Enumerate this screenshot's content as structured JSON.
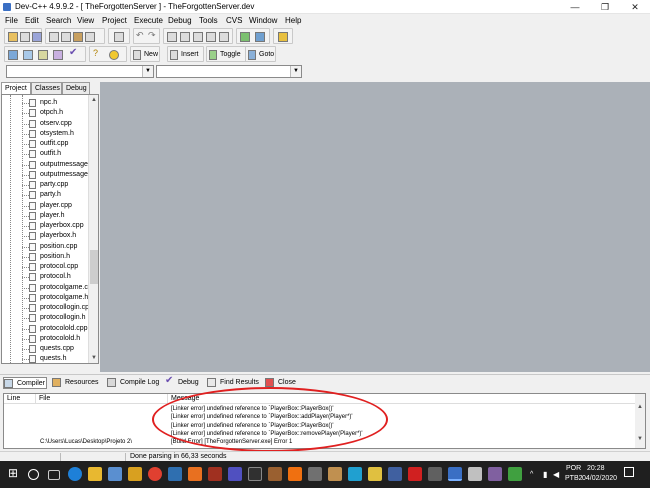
{
  "window": {
    "title": "Dev-C++ 4.9.9.2  -  [ TheForgottenServer ]  -  TheForgottenServer.dev",
    "minimize": "—",
    "maximize": "❐",
    "close": "✕"
  },
  "menu": [
    "File",
    "Edit",
    "Search",
    "View",
    "Project",
    "Execute",
    "Debug",
    "Tools",
    "CVS",
    "Window",
    "Help"
  ],
  "toolbar2": {
    "new_label": "New",
    "insert_label": "Insert",
    "toggle_label": "Toggle",
    "goto_label": "Goto"
  },
  "left_tabs": [
    "Project",
    "Classes",
    "Debug"
  ],
  "tree_items": [
    "npc.h",
    "otpch.h",
    "otserv.cpp",
    "otsystem.h",
    "outfit.cpp",
    "outfit.h",
    "outputmessage",
    "outputmessage",
    "party.cpp",
    "party.h",
    "player.cpp",
    "player.h",
    "playerbox.cpp",
    "playerbox.h",
    "position.cpp",
    "position.h",
    "protocol.cpp",
    "protocol.h",
    "protocolgame.c",
    "protocolgame.h",
    "protocollogin.cp",
    "protocollogin.h",
    "protocolold.cpp",
    "protocolold.h",
    "quests.cpp",
    "quests.h"
  ],
  "bottom_tabs": [
    "Compiler",
    "Resources",
    "Compile Log",
    "Debug",
    "Find Results",
    "Close"
  ],
  "messages": {
    "headers": {
      "line": "Line",
      "file": "File",
      "message": "Message"
    },
    "rows": [
      {
        "file": "",
        "message": "[Linker error] undefined reference to `PlayerBox::PlayerBox()'"
      },
      {
        "file": "",
        "message": "[Linker error] undefined reference to `PlayerBox::addPlayer(Player*)'"
      },
      {
        "file": "",
        "message": "[Linker error] undefined reference to `PlayerBox::PlayerBox()'"
      },
      {
        "file": "",
        "message": "[Linker error] undefined reference to `PlayerBox::removePlayer(Player*)'"
      },
      {
        "file": "C:\\Users\\Lucas\\Desktop\\Projeto 2\\",
        "message": "[Build Error]  [TheForgottenServer.exe] Error 1"
      }
    ]
  },
  "statusbar": {
    "text": "Done parsing in 66,33 seconds"
  },
  "taskbar": {
    "lang_top": "POR",
    "lang_bottom": "PTB2",
    "time": "20:28",
    "date": "04/02/2020"
  },
  "colors": {
    "annotation": "#e02020",
    "taskbar": "#1f1f1f",
    "editor_bg": "#abb1b8"
  }
}
